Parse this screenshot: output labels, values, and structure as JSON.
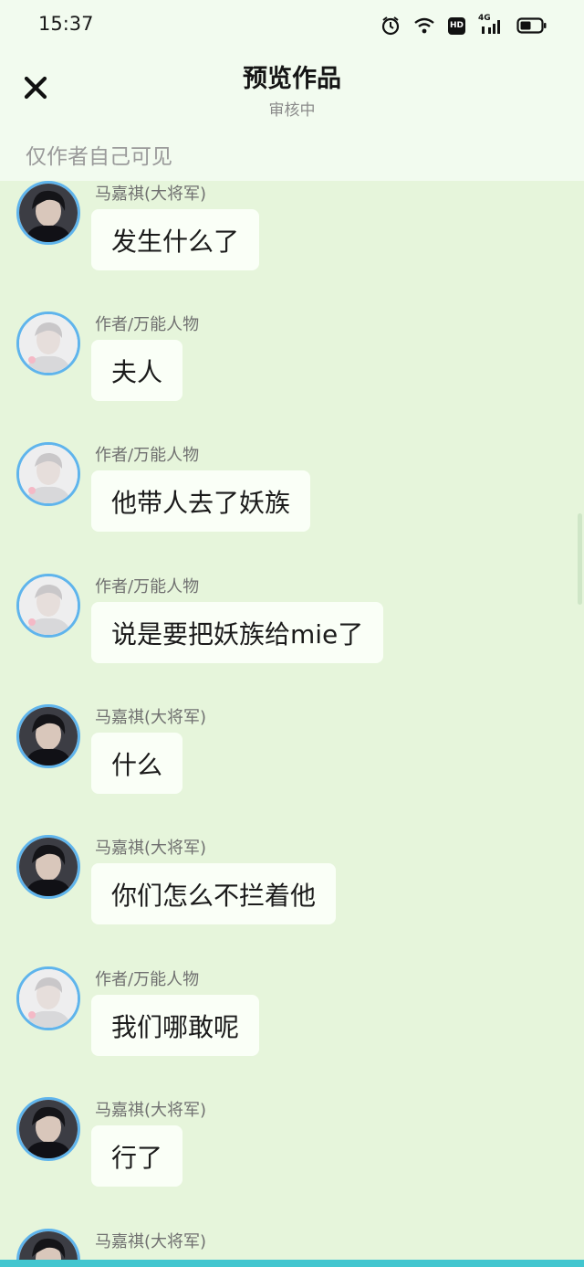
{
  "status_bar": {
    "time": "15:37",
    "network_label": "4G",
    "hd_label": "HD"
  },
  "header": {
    "title": "预览作品",
    "status": "审核中",
    "visibility_note": "仅作者自己可见"
  },
  "colors": {
    "background": "#e6f5db",
    "header_background": "#f2fbef",
    "bubble": "#fafff7",
    "avatar_ring": "#5fb4ec",
    "bottom_accent": "#43c6cf"
  },
  "messages": [
    {
      "speaker": "马嘉祺(大将军)",
      "text": "发生什么了",
      "avatar": "dark-avatar"
    },
    {
      "speaker": "作者/万能人物",
      "text": "夫人",
      "avatar": "light-avatar"
    },
    {
      "speaker": "作者/万能人物",
      "text": "他带人去了妖族",
      "avatar": "light-avatar"
    },
    {
      "speaker": "作者/万能人物",
      "text": "说是要把妖族给mie了",
      "avatar": "light-avatar"
    },
    {
      "speaker": "马嘉祺(大将军)",
      "text": "什么",
      "avatar": "dark-avatar"
    },
    {
      "speaker": "马嘉祺(大将军)",
      "text": "你们怎么不拦着他",
      "avatar": "dark-avatar"
    },
    {
      "speaker": "作者/万能人物",
      "text": "我们哪敢呢",
      "avatar": "light-avatar"
    },
    {
      "speaker": "马嘉祺(大将军)",
      "text": "行了",
      "avatar": "dark-avatar"
    },
    {
      "speaker": "马嘉祺(大将军)",
      "text": "",
      "avatar": "dark-avatar"
    }
  ]
}
